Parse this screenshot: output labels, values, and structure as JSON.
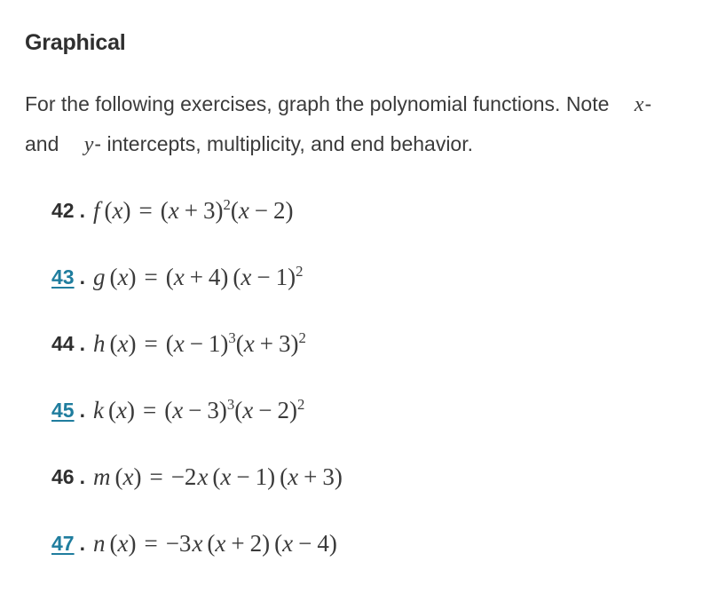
{
  "section": {
    "heading": "Graphical",
    "intro_part1": "For the following exercises, graph the polynomial functions. Note",
    "intro_var_x": "x",
    "intro_dash_1": "-",
    "intro_and": "and",
    "intro_var_y": "y",
    "intro_dash_2": "-",
    "intro_part2": "intercepts, multiplicity, and end behavior."
  },
  "colors": {
    "link": "#1f7d9e",
    "heading_text": "#2f2f2f",
    "body_text": "#3b3b3b",
    "math_text": "#3a3a3a",
    "background": "#ffffff"
  },
  "exercises": [
    {
      "number": "42",
      "is_link": false,
      "separator": ".",
      "fn_name": "f",
      "formula_plain": "f (x) = (x + 3)^2(x - 2)",
      "parts": {
        "lhs_var": "x",
        "eq": "=",
        "f1_open": "(",
        "f1_var": "x",
        "f1_op": "+",
        "f1_num": "3",
        "f1_close": ")",
        "f1_exp": "2",
        "f2_open": "(",
        "f2_var": "x",
        "f2_op": "−",
        "f2_num": "2",
        "f2_close": ")",
        "f2_exp": ""
      }
    },
    {
      "number": "43",
      "is_link": true,
      "separator": ".",
      "fn_name": "g",
      "formula_plain": "g (x) = (x + 4) (x - 1)^2",
      "parts": {
        "lhs_var": "x",
        "eq": "=",
        "f1_open": "(",
        "f1_var": "x",
        "f1_op": "+",
        "f1_num": "4",
        "f1_close": ")",
        "f1_exp": "",
        "f2_open": "(",
        "f2_var": "x",
        "f2_op": "−",
        "f2_num": "1",
        "f2_close": ")",
        "f2_exp": "2"
      }
    },
    {
      "number": "44",
      "is_link": false,
      "separator": ".",
      "fn_name": "h",
      "formula_plain": "h (x) = (x - 1)^3(x + 3)^2",
      "parts": {
        "lhs_var": "x",
        "eq": "=",
        "f1_open": "(",
        "f1_var": "x",
        "f1_op": "−",
        "f1_num": "1",
        "f1_close": ")",
        "f1_exp": "3",
        "f2_open": "(",
        "f2_var": "x",
        "f2_op": "+",
        "f2_num": "3",
        "f2_close": ")",
        "f2_exp": "2"
      }
    },
    {
      "number": "45",
      "is_link": true,
      "separator": ".",
      "fn_name": "k",
      "formula_plain": "k (x) = (x - 3)^3(x - 2)^2",
      "parts": {
        "lhs_var": "x",
        "eq": "=",
        "f1_open": "(",
        "f1_var": "x",
        "f1_op": "−",
        "f1_num": "3",
        "f1_close": ")",
        "f1_exp": "3",
        "f2_open": "(",
        "f2_var": "x",
        "f2_op": "−",
        "f2_num": "2",
        "f2_close": ")",
        "f2_exp": "2"
      }
    },
    {
      "number": "46",
      "is_link": false,
      "separator": ".",
      "fn_name": "m",
      "formula_plain": "m (x) = -2x (x - 1) (x + 3)",
      "parts": {
        "lhs_var": "x",
        "eq": "=",
        "coef": "−2",
        "coef_var": "x",
        "f1_open": "(",
        "f1_var": "x",
        "f1_op": "−",
        "f1_num": "1",
        "f1_close": ")",
        "f1_exp": "",
        "f2_open": "(",
        "f2_var": "x",
        "f2_op": "+",
        "f2_num": "3",
        "f2_close": ")",
        "f2_exp": ""
      }
    },
    {
      "number": "47",
      "is_link": true,
      "separator": ".",
      "fn_name": "n",
      "formula_plain": "n (x) = -3x (x + 2) (x - 4)",
      "parts": {
        "lhs_var": "x",
        "eq": "=",
        "coef": "−3",
        "coef_var": "x",
        "f1_open": "(",
        "f1_var": "x",
        "f1_op": "+",
        "f1_num": "2",
        "f1_close": ")",
        "f1_exp": "",
        "f2_open": "(",
        "f2_var": "x",
        "f2_op": "−",
        "f2_num": "4",
        "f2_close": ")",
        "f2_exp": ""
      }
    }
  ]
}
